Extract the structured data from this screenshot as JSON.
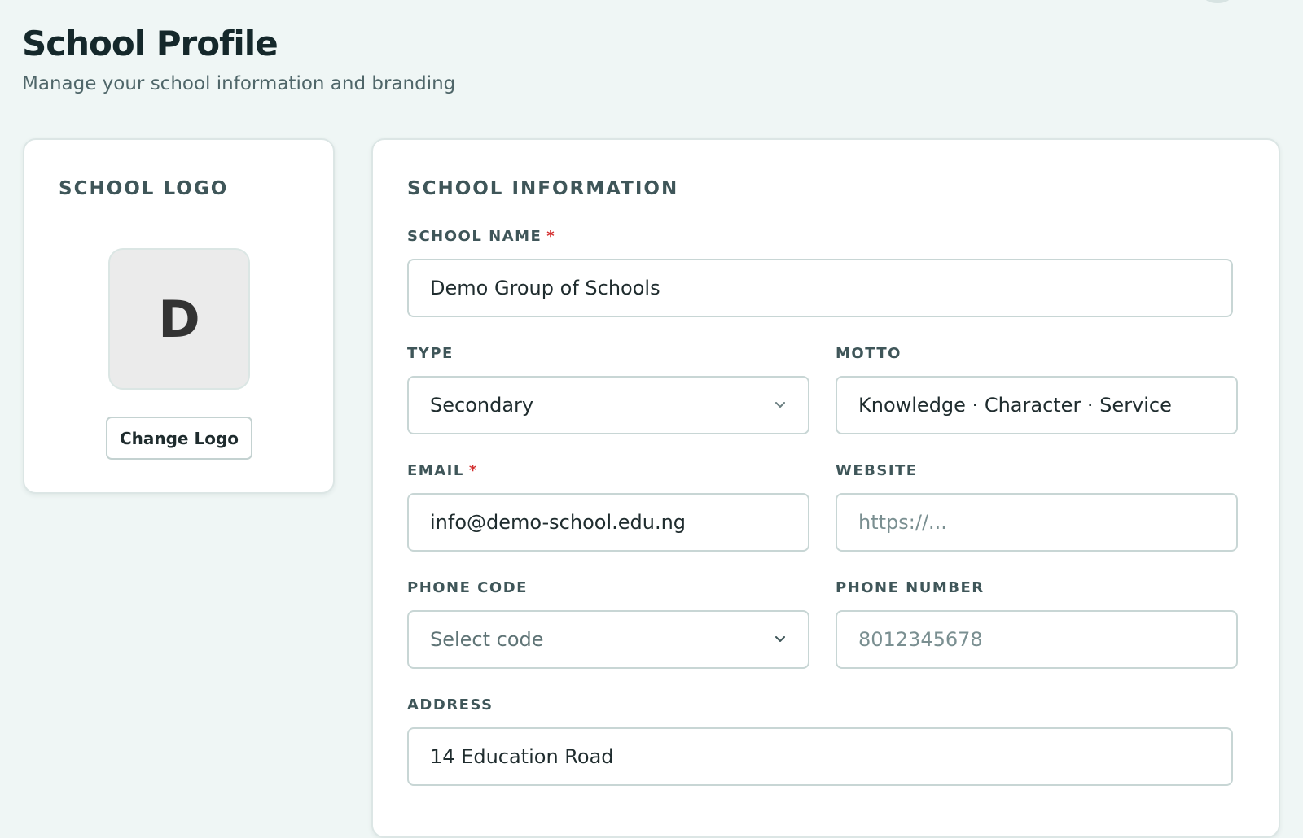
{
  "header": {
    "title": "School Profile",
    "subtitle": "Manage your school information and branding"
  },
  "logo_card": {
    "title": "SCHOOL LOGO",
    "logo_letter": "D",
    "change_logo_label": "Change Logo"
  },
  "info_card": {
    "title": "SCHOOL INFORMATION",
    "fields": {
      "school_name": {
        "label": "SCHOOL NAME",
        "required": "*",
        "value": "Demo Group of Schools"
      },
      "type": {
        "label": "TYPE",
        "value": "Secondary",
        "icon": "chevron-down-icon"
      },
      "motto": {
        "label": "MOTTO",
        "value": "Knowledge · Character · Service"
      },
      "email": {
        "label": "EMAIL",
        "required": "*",
        "value": "info@demo-school.edu.ng"
      },
      "website": {
        "label": "WEBSITE",
        "value": "",
        "placeholder": "https://..."
      },
      "phone_code": {
        "label": "PHONE CODE",
        "value": "Select code",
        "icon": "chevron-down-icon"
      },
      "phone_number": {
        "label": "PHONE NUMBER",
        "value": "",
        "placeholder": "8012345678"
      },
      "address": {
        "label": "ADDRESS",
        "value": "14 Education Road"
      }
    }
  },
  "colors": {
    "background": "#eff6f5",
    "required": "#d32f2f",
    "label": "#3f5659"
  }
}
